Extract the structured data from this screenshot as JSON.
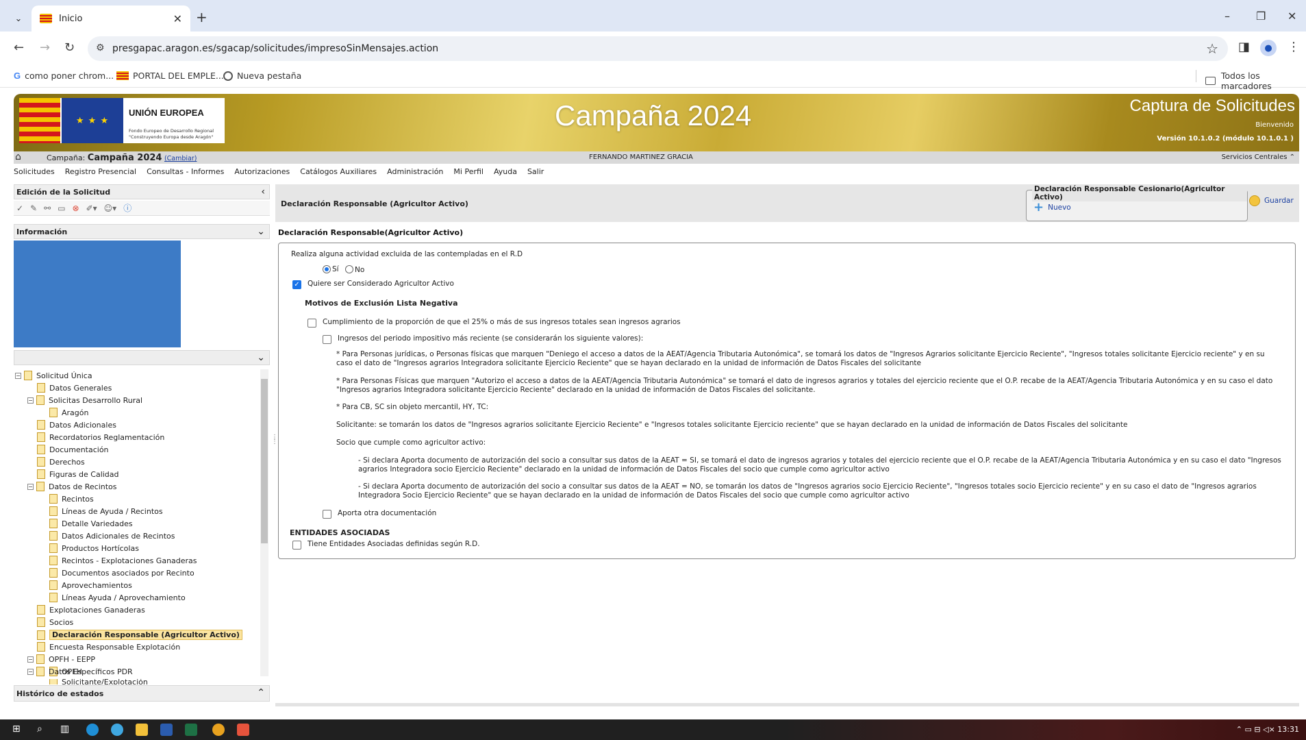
{
  "browser": {
    "tab_title": "Inicio",
    "url": "presgapac.aragon.es/sgacap/solicitudes/impresoSinMensajes.action",
    "bookmarks": [
      "como poner chrom...",
      "PORTAL DEL EMPLE...",
      "Nueva pestaña"
    ],
    "all_bookmarks": "Todos los marcadores"
  },
  "banner": {
    "eu_title": "UNIÓN EUROPEA",
    "eu_sub1": "Fondo Europeo de Desarrollo Regional",
    "eu_sub2": "\"Construyendo Europa desde Aragón\"",
    "campaign": "Campaña 2024",
    "app_title": "Captura de Solicitudes",
    "welcome": "Bienvenido",
    "version": "Versión 10.1.0.2 (módulo 10.1.0.1 )"
  },
  "campaign_bar": {
    "label": "Campaña:",
    "value": "Campaña 2024",
    "change": "(Cambiar)",
    "user": "FERNANDO MARTINEZ GRACIA",
    "services": "Servicios Centrales ⌃"
  },
  "menu": [
    "Solicitudes",
    "Registro Presencial",
    "Consultas - Informes",
    "Autorizaciones",
    "Catálogos Auxiliares",
    "Administración",
    "Mi Perfil",
    "Ayuda",
    "Salir"
  ],
  "left": {
    "edit_title": "Edición de la Solicitud",
    "info_title": "Información",
    "history_title": "Histórico de estados",
    "tree": [
      {
        "label": "Solicitud Única"
      },
      {
        "label": "Datos Generales"
      },
      {
        "label": "Solicitas Desarrollo Rural"
      },
      {
        "label": "Aragón"
      },
      {
        "label": "Datos Adicionales"
      },
      {
        "label": "Recordatorios Reglamentación"
      },
      {
        "label": "Documentación"
      },
      {
        "label": "Derechos"
      },
      {
        "label": "Figuras de Calidad"
      },
      {
        "label": "Datos de Recintos"
      },
      {
        "label": "Recintos"
      },
      {
        "label": "Líneas de Ayuda / Recintos"
      },
      {
        "label": "Detalle Variedades"
      },
      {
        "label": "Datos Adicionales de Recintos"
      },
      {
        "label": "Productos Hortícolas"
      },
      {
        "label": "Recintos - Explotaciones Ganaderas"
      },
      {
        "label": "Documentos asociados por Recinto"
      },
      {
        "label": "Aprovechamientos"
      },
      {
        "label": "Líneas Ayuda / Aprovechamiento"
      },
      {
        "label": "Explotaciones Ganaderas"
      },
      {
        "label": "Socios"
      },
      {
        "label": "Declaración Responsable (Agricultor Activo)"
      },
      {
        "label": "Encuesta Responsable Explotación"
      },
      {
        "label": "OPFH - EEPP"
      },
      {
        "label": "OPFH"
      },
      {
        "label": "Datos Específicos PDR"
      },
      {
        "label": "Solicitante/Explotación"
      }
    ]
  },
  "main": {
    "page_title": "Declaración Responsable (Agricultor Activo)",
    "fieldset_legend": "Declaración Responsable Cesionario(Agricultor Activo)",
    "new_label": "Nuevo",
    "save_label": "Guardar",
    "section_title": "Declaración Responsable(Agricultor Activo)",
    "q_excluded": "Realiza alguna actividad excluida de las contempladas en el R.D",
    "opt_yes": "Sí",
    "opt_no": "No",
    "want_active": "Quiere ser Considerado Agricultor Activo",
    "motivos_title": "Motivos de Exclusión Lista Negativa",
    "cumplimiento": "Cumplimiento de la proporción de que el 25% o más de sus ingresos totales sean ingresos agrarios",
    "ingresos": "Ingresos del periodo impositivo más reciente (se considerarán los siguiente valores):",
    "p1": "* Para Personas jurídicas, o Personas físicas que marquen \"Deniego el acceso a datos de la AEAT/Agencia Tributaria Autonómica\", se tomará los datos de \"Ingresos Agrarios solicitante Ejercicio Reciente\", \"Ingresos totales solicitante Ejercicio reciente\" y en su caso el dato de \"Ingresos agrarios Integradora solicitante Ejercicio Reciente\" que se hayan declarado en la unidad de información de Datos Fiscales del solicitante",
    "p2": "* Para Personas Físicas que marquen \"Autorizo el acceso a datos de la AEAT/Agencia Tributaria Autonómica\" se tomará el dato de ingresos agrarios y totales del ejercicio reciente que el O.P. recabe de la AEAT/Agencia Tributaria Autonómica y en su caso el dato \"Ingresos agrarios Integradora solicitante Ejercicio Reciente\" declarado en la unidad de información de Datos Fiscales del solicitante.",
    "p3": "* Para CB, SC sin objeto mercantil, HY, TC:",
    "p4": "Solicitante: se tomarán los datos de \"Ingresos agrarios solicitante Ejercicio Reciente\" e \"Ingresos totales solicitante Ejercicio reciente\" que se hayan declarado en la unidad de información de Datos Fiscales del solicitante",
    "p5": "Socio que cumple como agricultor activo:",
    "p6": "- Si declara Aporta documento de autorización del socio a consultar sus datos de la AEAT = SI, se tomará el dato de ingresos agrarios y totales del ejercicio reciente que el O.P. recabe de la AEAT/Agencia Tributaria Autonómica y en su caso el dato \"Ingresos agrarios Integradora socio Ejercicio Reciente\" declarado en la unidad de información de Datos Fiscales del socio que cumple como agricultor activo",
    "p7": "- Si declara Aporta documento de autorización del socio a consultar sus datos de la AEAT = NO, se tomarán los datos de \"Ingresos agrarios socio Ejercicio Reciente\", \"Ingresos totales socio Ejercicio reciente\" y en su caso el dato de \"Ingresos agrarios Integradora Socio Ejercicio Reciente\" que se hayan declarado en la unidad de información de Datos Fiscales del socio que cumple como agricultor activo",
    "otra_doc": "Aporta otra documentación",
    "entidades_title": "ENTIDADES ASOCIADAS",
    "entidades": "Tiene Entidades Asociadas definidas según R.D."
  },
  "taskbar": {
    "time": "13:31"
  }
}
